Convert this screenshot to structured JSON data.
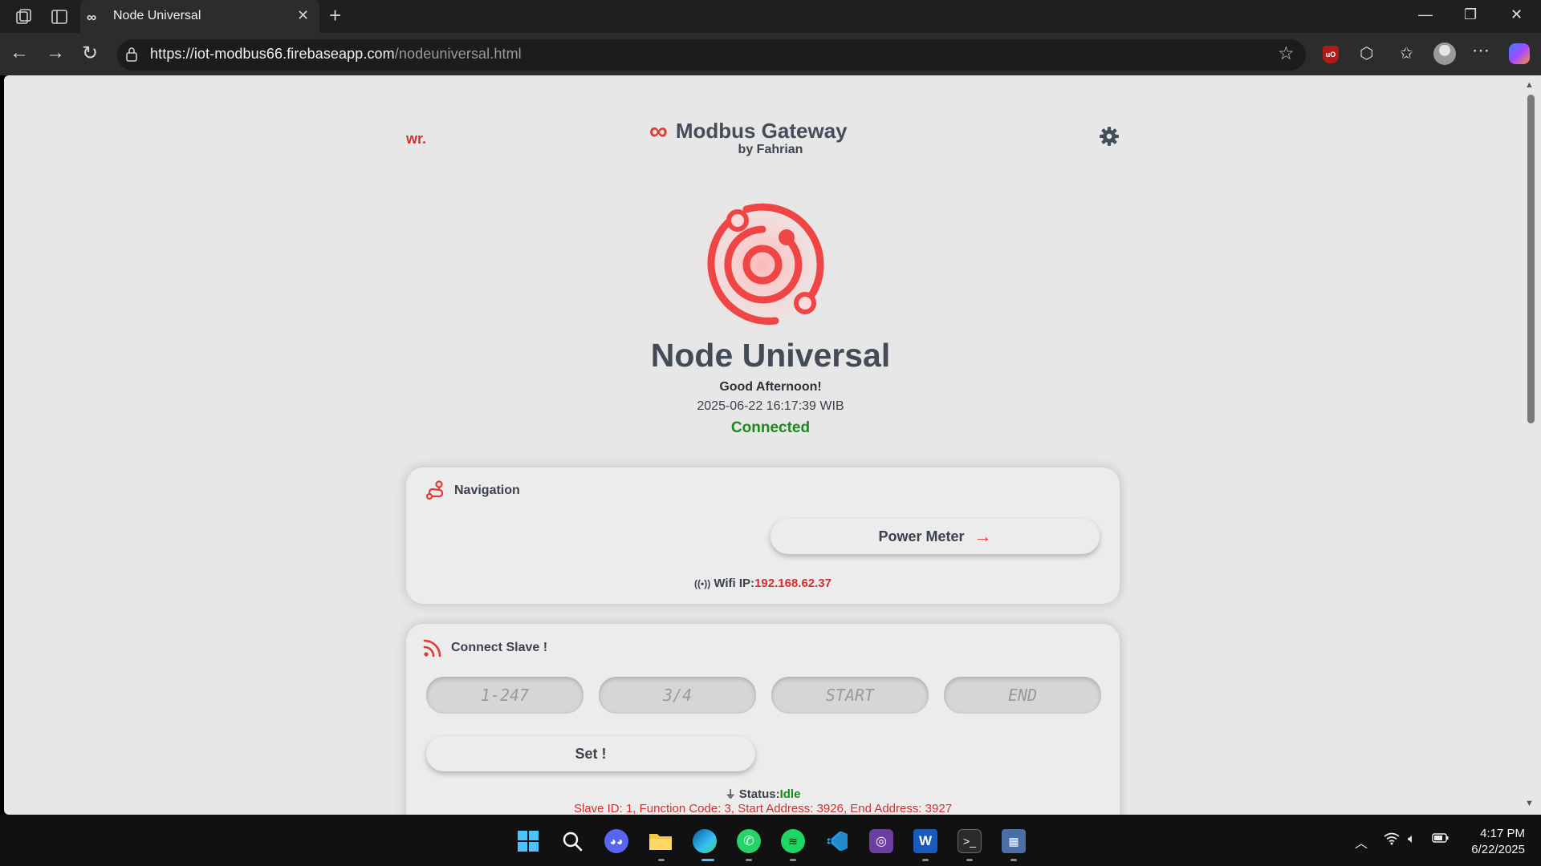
{
  "browser": {
    "tab_title": "Node Universal",
    "tab_favicon": "∞",
    "url_host": "https://iot-modbus66.firebaseapp.com",
    "url_path": "/nodeuniversal.html",
    "ublock_label": "uO"
  },
  "page": {
    "logo_text": "wr.",
    "brand_icon": "∞",
    "brand_title": "Modbus Gateway",
    "byline": "by Fahrian",
    "title": "Node Universal",
    "greeting": "Good Afternoon!",
    "datetime": "2025-06-22 16:17:39 WIB",
    "connection_status": "Connected",
    "accent_color": "#e53935",
    "connected_color": "#1b8a1b"
  },
  "navigation_card": {
    "title": "Navigation",
    "power_meter_button": "Power Meter",
    "power_meter_arrow": "→",
    "wifi_label": "Wifi IP:",
    "wifi_ip": "192.168.62.37"
  },
  "connect_card": {
    "title": "Connect Slave !",
    "inputs": {
      "slave_id_placeholder": "1-247",
      "function_code_placeholder": "3/4",
      "start_placeholder": "START",
      "end_placeholder": "END"
    },
    "set_button": "Set !",
    "status_label": "Status:",
    "status_value": "Idle",
    "detail": "Slave ID: 1, Function Code: 3, Start Address: 3926, End Address: 3927"
  },
  "taskbar": {
    "time": "4:17 PM",
    "date": "6/22/2025"
  }
}
